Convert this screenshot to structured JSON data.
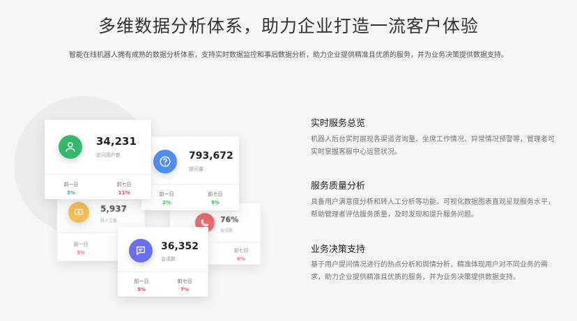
{
  "header": {
    "title": "多维数据分析体系，助力企业打造一流客户体验",
    "subtitle": "智能在线机器人拥有成熟的数据分析体系，支持实时数据监控和事后数据分析，助力企业提供精准且优质的服务，并为业务决策提供数据支持。"
  },
  "cards": {
    "visitors": {
      "value": "34,231",
      "label": "访问用户数",
      "stat1_label": "前一日",
      "stat1_value": "3%",
      "stat2_label": "前七日",
      "stat2_value": "11%",
      "icon": "user-icon",
      "color": "#35b86b"
    },
    "questions": {
      "value": "793,672",
      "label": "提问量",
      "stat1_label": "前一日",
      "stat1_value": "2%",
      "stat2_label": "前七日",
      "stat2_value": "5%",
      "icon": "question-icon",
      "color": "#4f8ef7"
    },
    "transfers": {
      "value": "5,937",
      "label": "转人工数",
      "stat1_label": "前一日",
      "stat1_value": "3%",
      "icon": "transfer-icon",
      "color": "#f2b233"
    },
    "rate": {
      "value": "76%",
      "label": "会话数",
      "stat2_label": "前七日",
      "stat2_value": "6%",
      "icon": "phone-icon",
      "color": "#e34b4b"
    },
    "sessions": {
      "value": "36,352",
      "label": "会话数",
      "stat1_label": "前一日",
      "stat1_value": "5%",
      "stat2_label": "前七日",
      "stat2_value": "7%",
      "icon": "chat-icon",
      "color": "#6a6ff0"
    }
  },
  "features": [
    {
      "title": "实时服务总览",
      "text": "机器人后台实时展现各渠道咨询量、坐席工作情况、异常情况预警等，管理者可实时掌握客服中心运营状况。"
    },
    {
      "title": "服务质量分析",
      "text": "具备用户满意度分析和转人工分析等功能，可视化数据图表直观呈现服务水平，帮助管理者评估服务质量，及时发现和提升服务问题。"
    },
    {
      "title": "业务决策支持",
      "text": "基于用户提问情况进行的热点分析和舆情分析，精准体现用户对不同业务的需求，助力企业提供精准且优质的服务，并为业务决策提供数据支持。"
    }
  ]
}
